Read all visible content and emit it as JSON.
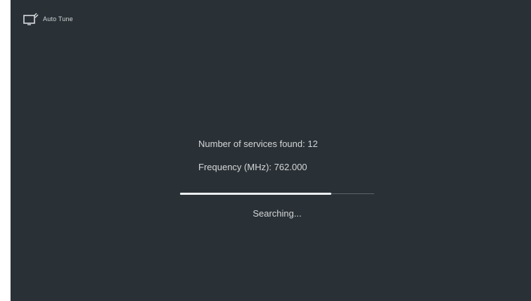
{
  "header": {
    "title": "Auto Tune",
    "icon": "tv-scan-icon"
  },
  "scan": {
    "services_label": "Number of services found:",
    "services_value": "12",
    "frequency_label": "Frequency (MHz):",
    "frequency_value": "762.000",
    "progress_fraction": 0.78,
    "status_text": "Searching..."
  },
  "colors": {
    "background": "#2a3136",
    "text": "#d2d6d9",
    "progress_fill": "#eceff1",
    "progress_track": "#5e666b"
  }
}
